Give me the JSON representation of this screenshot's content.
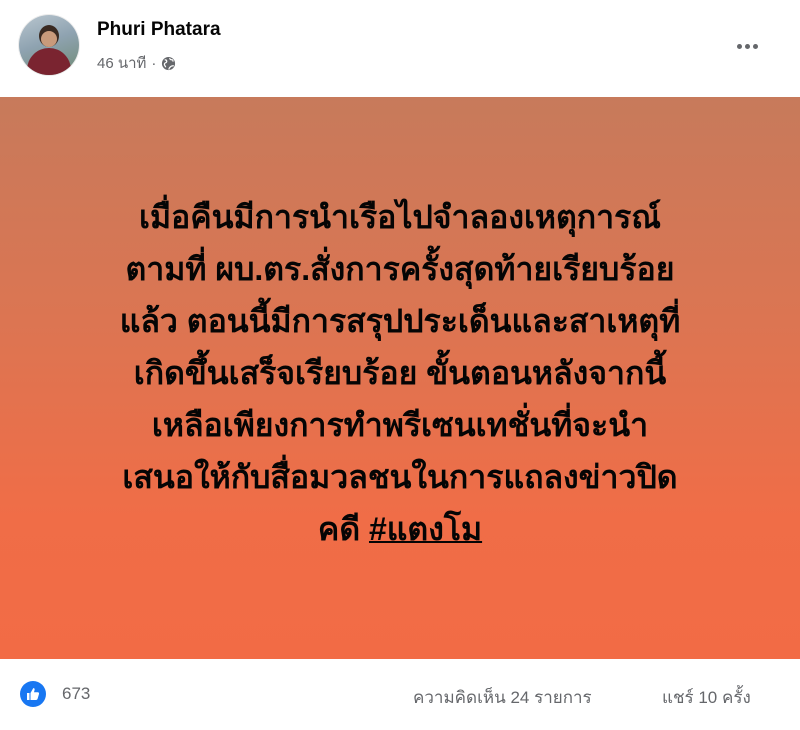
{
  "post": {
    "author": "Phuri Phatara",
    "time": "46 นาที",
    "separator": "·",
    "privacy_icon": "globe-icon",
    "text_lines": [
      "เมื่อคืนมีการนำเรือไปจำลองเหตุการณ์",
      "ตามที่ ผบ.ตร.สั่งการครั้งสุดท้ายเรียบร้อย",
      "แล้ว ตอนนี้มีการสรุปประเด็นและสาเหตุที่",
      "เกิดขึ้นเสร็จเรียบร้อย ขั้นตอนหลังจากนี้",
      "เหลือเพียงการทำพรีเซนเทชั่นที่จะนำ",
      "เสนอให้กับสื่อมวลชนในการแถลงข่าวปิด"
    ],
    "last_line_prefix": "คดี ",
    "hashtag": "#แตงโม",
    "background_colors": [
      "#c77a5b",
      "#f26b45"
    ]
  },
  "footer": {
    "reaction_icon": "like-icon",
    "like_count": "673",
    "comments": "ความคิดเห็น 24 รายการ",
    "shares": "แชร์ 10 ครั้ง",
    "accent": "#1877f2"
  }
}
